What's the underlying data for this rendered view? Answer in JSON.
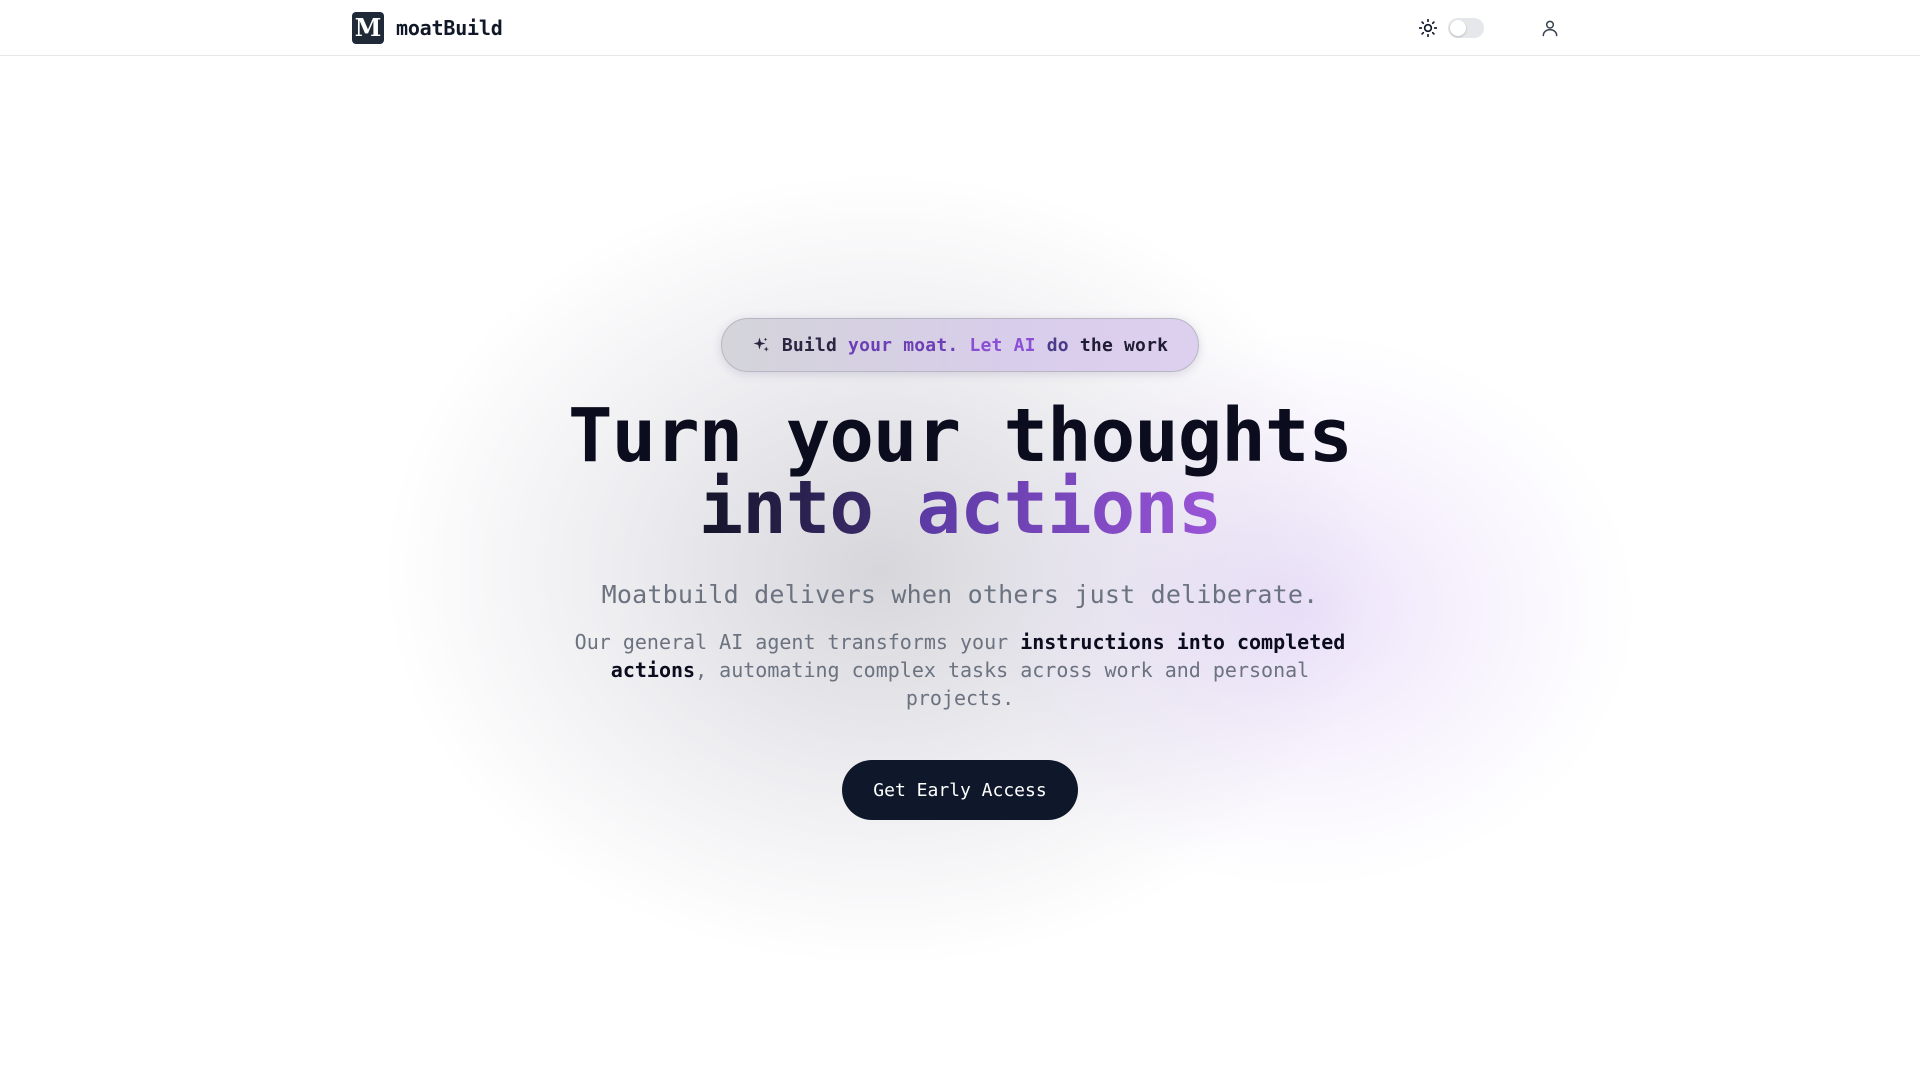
{
  "header": {
    "logo_letter": "M",
    "brand_name": "moatBuild",
    "theme_toggle_state": "light",
    "icons": [
      "sun-icon",
      "user-icon"
    ]
  },
  "hero": {
    "badge": {
      "icon": "sparkles-icon",
      "segments": [
        "Build",
        "your moat.",
        "Let AI",
        "do",
        "the work"
      ]
    },
    "title_line1": "Turn your thoughts",
    "title_line2_a": "into",
    "title_line2_b": "actions",
    "tagline": "Moatbuild delivers when others just deliberate.",
    "description": {
      "part1": "Our general AI agent transforms your ",
      "bold": "instructions into completed actions",
      "part2": ", automating complex tasks across work and personal projects."
    },
    "cta_label": "Get Early Access"
  },
  "colors": {
    "accent_purple": "#8b4fd6",
    "button_dark": "#0f172a",
    "text_muted": "#6b7280"
  }
}
